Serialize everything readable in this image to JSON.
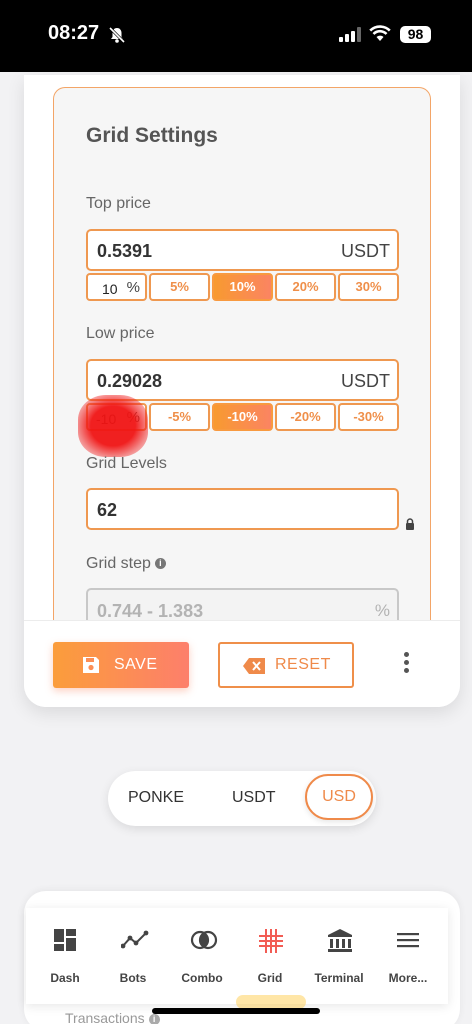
{
  "status_bar": {
    "time": "08:27",
    "battery": "98"
  },
  "grid_settings": {
    "title": "Grid Settings",
    "top_price": {
      "label": "Top price",
      "value": "0.5391",
      "unit": "USDT",
      "custom_percent": "10",
      "percent_sign": "%",
      "presets": [
        "5%",
        "10%",
        "20%",
        "30%"
      ],
      "active_preset": "10%"
    },
    "low_price": {
      "label": "Low price",
      "value": "0.29028",
      "unit": "USDT",
      "custom_percent": "-10",
      "percent_sign": "%",
      "presets": [
        "-5%",
        "-10%",
        "-20%",
        "-30%"
      ],
      "active_preset": "-10%"
    },
    "grid_levels": {
      "label": "Grid Levels",
      "value": "62"
    },
    "grid_step": {
      "label": "Grid step",
      "value": "0.744 - 1.383",
      "unit": "%"
    }
  },
  "actions": {
    "save_label": "SAVE",
    "reset_label": "RESET"
  },
  "currency_toggle": {
    "options": [
      "PONKE",
      "USDT",
      "USD"
    ],
    "selected": "USD"
  },
  "tabs": [
    {
      "label": "Dash",
      "icon": "dashboard-icon"
    },
    {
      "label": "Bots",
      "icon": "chart-line-icon"
    },
    {
      "label": "Combo",
      "icon": "combo-icon"
    },
    {
      "label": "Grid",
      "icon": "grid-icon",
      "active": true
    },
    {
      "label": "Terminal",
      "icon": "bank-icon"
    },
    {
      "label": "More...",
      "icon": "menu-icon"
    }
  ],
  "partial_text": {
    "transactions": "Transactions"
  },
  "colors": {
    "accent": "#ef8f4a",
    "gradient_start": "#fb9d3b",
    "gradient_end": "#fd7f6b",
    "active_tab": "#f25c54"
  }
}
